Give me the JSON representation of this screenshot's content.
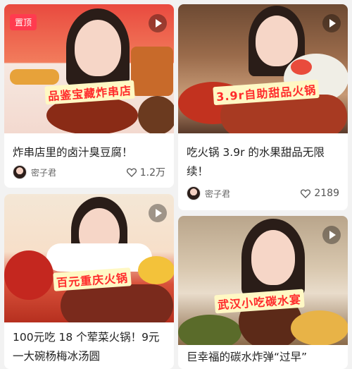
{
  "cards": [
    {
      "pinned_badge": "置顶",
      "overlay_text": "品鉴宝藏炸串店",
      "title": "炸串店里的卤汁臭豆腐！",
      "author": "密子君",
      "likes": "1.2万"
    },
    {
      "overlay_text": "3.9r自助甜品火锅",
      "title": "吃火锅 3.9r 的水果甜品无限续！",
      "author": "密子君",
      "likes": "2189"
    },
    {
      "overlay_text": "百元重庆火锅",
      "title": "100元吃 18 个荤菜火锅！9元一大碗杨梅冰汤圆"
    },
    {
      "overlay_text": "武汉小吃碳水宴",
      "title": "巨幸福的碳水炸弹“过早”"
    }
  ],
  "icons": {
    "play": "play-icon",
    "like": "heart-icon",
    "avatar": "avatar"
  },
  "colors": {
    "pin_badge": "#ff3b4f",
    "overlay_text": "#ff2b2b"
  }
}
